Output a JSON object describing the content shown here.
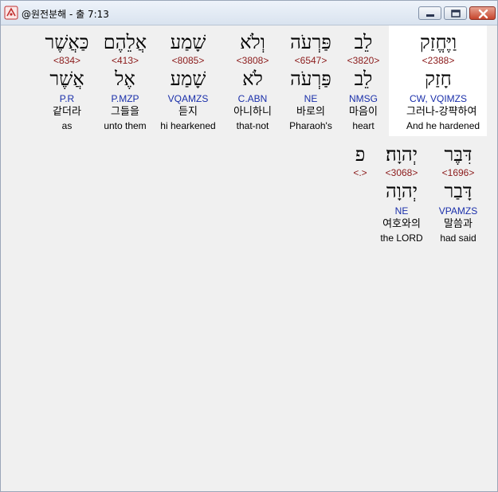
{
  "window": {
    "title": "@원전분해 - 출 7:13",
    "colors": {
      "hebrew": "#000000",
      "strong": "#8b1a1a",
      "morph": "#1a2faa",
      "gloss": "#000000",
      "highlight": "#ffffff"
    }
  },
  "row1": [
    {
      "heb": "וַיֶּחֱזַק",
      "strong": "<2388>",
      "lemma": "חָזַק",
      "morph": "CW, VQIMZS",
      "korean": "그러나-강퍅하여",
      "english": "And he hardened",
      "highlighted": true
    },
    {
      "heb": "לֵב",
      "strong": "<3820>",
      "lemma": "לֵב",
      "morph": "NMSG",
      "korean": "마음이",
      "english": "heart"
    },
    {
      "heb": "פַּרְעֹה",
      "strong": "<6547>",
      "lemma": "פַּרְעֹה",
      "morph": "NE",
      "korean": "바로의",
      "english": "Pharaoh's"
    },
    {
      "heb": "וְלֹא",
      "strong": "<3808>",
      "lemma": "לֹא",
      "morph": "C.ABN",
      "korean": "아니하니",
      "english": "that-not"
    },
    {
      "heb": "שָׁמַע",
      "strong": "<8085>",
      "lemma": "שָׁמַע",
      "morph": "VQAMZS",
      "korean": "듣지",
      "english": "hi hearkened"
    },
    {
      "heb": "אֲלֵהֶם",
      "strong": "<413>",
      "lemma": "אֶל",
      "morph": "P.MZP",
      "korean": "그들을",
      "english": "unto them"
    },
    {
      "heb": "כַּאֲשֶׁר",
      "strong": "<834>",
      "lemma": "אֲשֶׁר",
      "morph": "P.R",
      "korean": "같더라",
      "english": "as"
    }
  ],
  "row2": [
    {
      "heb": "דִּבֶּר",
      "strong": "<1696>",
      "lemma": "דָּבַר",
      "morph": "VPAMZS",
      "korean": "말씀과",
      "english": "had said"
    },
    {
      "heb": "יְהוָה׃",
      "strong": "<3068>",
      "lemma": "יְהוָה",
      "morph": "NE",
      "korean": "여호와의",
      "english": "the LORD"
    },
    {
      "heb": "פ",
      "strong": "<.>",
      "lemma": "",
      "morph": "",
      "korean": "",
      "english": ""
    }
  ]
}
